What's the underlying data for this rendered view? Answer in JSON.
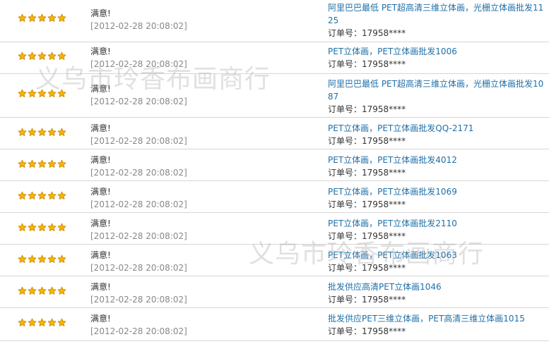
{
  "watermark_text": "义乌市玲香布画商行",
  "colors": {
    "product_link": "#1e6fa8",
    "date": "#888888",
    "divider": "#d6d6d6",
    "star_fill": "#f5b400",
    "star_stroke": "#c88400"
  },
  "rating_icon": "star-icon",
  "reviews": [
    {
      "stars": 5,
      "comment": "满意!",
      "date": "[2012-02-28 20:08:02]",
      "product": "阿里巴巴最低 PET超高清三维立体画，光栅立体画批发1125",
      "order": "订单号：17958****"
    },
    {
      "stars": 5,
      "comment": "满意!",
      "date": "[2012-02-28 20:08:02]",
      "product": "PET立体画，PET立体画批发1006",
      "order": "订单号：17958****"
    },
    {
      "stars": 5,
      "comment": "满意!",
      "date": "[2012-02-28 20:08:02]",
      "product": "阿里巴巴最低 PET超高清三维立体画，光栅立体画批发1087",
      "order": "订单号：17958****"
    },
    {
      "stars": 5,
      "comment": "满意!",
      "date": "[2012-02-28 20:08:02]",
      "product": "PET立体画，PET立体画批发QQ-2171",
      "order": "订单号：17958****"
    },
    {
      "stars": 5,
      "comment": "满意!",
      "date": "[2012-02-28 20:08:02]",
      "product": "PET立体画，PET立体画批发4012",
      "order": "订单号：17958****"
    },
    {
      "stars": 5,
      "comment": "满意!",
      "date": "[2012-02-28 20:08:02]",
      "product": "PET立体画，PET立体画批发1069",
      "order": "订单号：17958****"
    },
    {
      "stars": 5,
      "comment": "满意!",
      "date": "[2012-02-28 20:08:02]",
      "product": "PET立体画，PET立体画批发2110",
      "order": "订单号：17958****"
    },
    {
      "stars": 5,
      "comment": "满意!",
      "date": "[2012-02-28 20:08:02]",
      "product": "PET立体画，PET立体画批发1063",
      "order": "订单号：17958****"
    },
    {
      "stars": 5,
      "comment": "满意!",
      "date": "[2012-02-28 20:08:02]",
      "product": "批发供应高清PET立体画1046",
      "order": "订单号：17958****"
    },
    {
      "stars": 5,
      "comment": "满意!",
      "date": "[2012-02-28 20:08:02]",
      "product": "批发供应PET三维立体画，PET高清三维立体画1015",
      "order": "订单号：17958****"
    }
  ]
}
